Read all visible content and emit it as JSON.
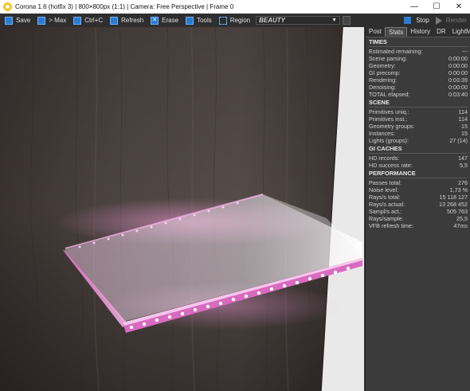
{
  "window": {
    "title": "Corona 1.6 (hotfix 3) | 800×800px (1:1) | Camera: Free Perspective | Frame 0",
    "controls": {
      "minimize": "—",
      "maximize": "☐",
      "close": "✕"
    }
  },
  "toolbar": {
    "save": "Save",
    "max": "> Max",
    "copy": "Ctrl+C",
    "refresh": "Refresh",
    "erase": "Erase",
    "tools": "Tools",
    "region": "Region",
    "pass_value": "BEAUTY",
    "stop": "Stop",
    "render": "Render",
    "icons": [
      "save-icon",
      "max-icon",
      "copy-icon",
      "refresh-icon",
      "erase-icon",
      "tools-icon",
      "region-icon"
    ]
  },
  "tabs": [
    "Post",
    "Stats",
    "History",
    "DR",
    "LightMix"
  ],
  "active_tab": "Stats",
  "stats": {
    "times": {
      "title": "TIMES",
      "rows": [
        {
          "label": "Estimated remaining:",
          "value": "---"
        },
        {
          "label": "Scene parsing:",
          "value": "0:00:00"
        },
        {
          "label": "Geometry:",
          "value": "0:00:00"
        },
        {
          "label": "GI precomp:",
          "value": "0:00:00"
        },
        {
          "label": "Rendering:",
          "value": "0:03:39"
        },
        {
          "label": "Denoising:",
          "value": "0:00:00"
        },
        {
          "label": "TOTAL elapsed:",
          "value": "0:03:40"
        }
      ]
    },
    "scene": {
      "title": "SCENE",
      "rows": [
        {
          "label": "Primitives uniq.:",
          "value": "114"
        },
        {
          "label": "Primitives inst.:",
          "value": "114"
        },
        {
          "label": "Geometry groups:",
          "value": "15"
        },
        {
          "label": "Instances:",
          "value": "15"
        },
        {
          "label": "Lights (groups):",
          "value": "27 (14)"
        }
      ]
    },
    "gi": {
      "title": "GI CACHES",
      "rows": [
        {
          "label": "HD records:",
          "value": "147"
        },
        {
          "label": "HD success rate:",
          "value": "5,5"
        }
      ]
    },
    "perf": {
      "title": "PERFORMANCE",
      "rows": [
        {
          "label": "Passes total:",
          "value": "276"
        },
        {
          "label": "Noise level:",
          "value": "1,73 %"
        },
        {
          "label": "Rays/s total:",
          "value": "15 118 127"
        },
        {
          "label": "Rays/s actual:",
          "value": "13 268 452"
        },
        {
          "label": "Sampl/s act.:",
          "value": "505 763"
        },
        {
          "label": "Rays/sample:",
          "value": "25,5"
        },
        {
          "label": "VFB refresh time:",
          "value": "47ms"
        }
      ]
    }
  },
  "colors": {
    "accent": "#2b7bd1",
    "glow": "#e48ad4",
    "wood": "#4a3f3a"
  }
}
